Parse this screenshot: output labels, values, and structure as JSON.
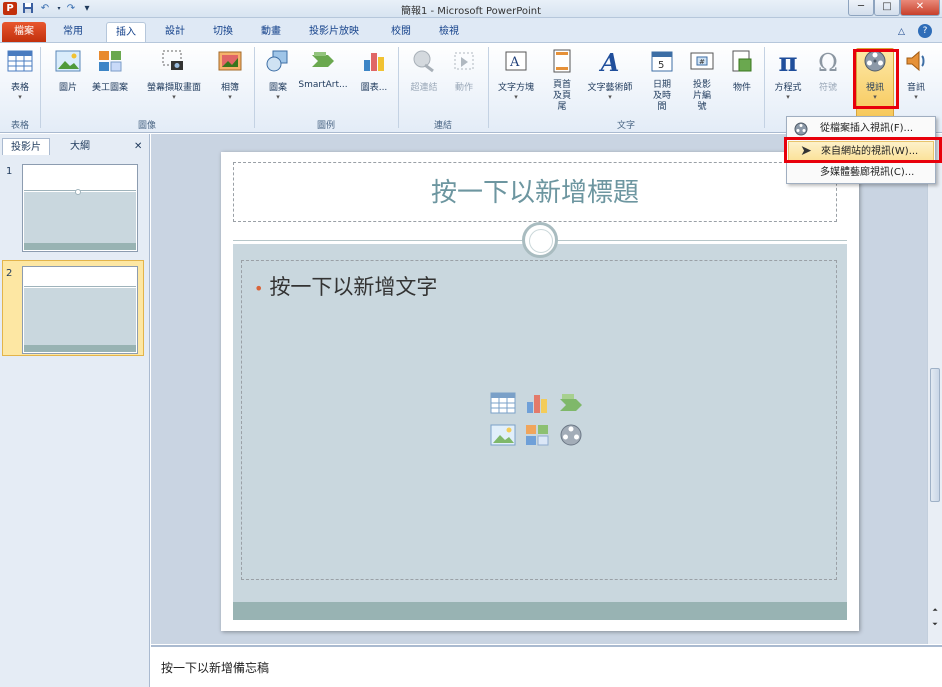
{
  "window": {
    "title": "簡報1 - Microsoft PowerPoint",
    "minimize_label": "─",
    "maximize_label": "□",
    "close_label": "✕"
  },
  "quick_access": {
    "app_icon": "P",
    "save_icon": "floppy-disk-icon",
    "undo_icon": "undo-icon",
    "redo_icon": "redo-icon",
    "customize": "▾"
  },
  "tabs": [
    {
      "label": "檔案",
      "active": false
    },
    {
      "label": "常用",
      "active": false
    },
    {
      "label": "插入",
      "active": true
    },
    {
      "label": "設計",
      "active": false
    },
    {
      "label": "切換",
      "active": false
    },
    {
      "label": "動畫",
      "active": false
    },
    {
      "label": "投影片放映",
      "active": false
    },
    {
      "label": "校閱",
      "active": false
    },
    {
      "label": "檢視",
      "active": false
    }
  ],
  "ribbon": {
    "buttons": [
      {
        "label": "表格",
        "icon": "table-icon",
        "has_arrow": true,
        "disabled": false
      },
      {
        "label": "圖片",
        "icon": "picture-icon",
        "has_arrow": false,
        "disabled": false
      },
      {
        "label": "美工圖案",
        "icon": "clipart-icon",
        "has_arrow": false,
        "disabled": false
      },
      {
        "label": "螢幕擷取畫面",
        "icon": "screenshot-icon",
        "has_arrow": true,
        "disabled": false
      },
      {
        "label": "相簿",
        "icon": "photo-album-icon",
        "has_arrow": true,
        "disabled": false
      },
      {
        "label": "圖案",
        "icon": "shapes-icon",
        "has_arrow": true,
        "disabled": false
      },
      {
        "label": "SmartArt...",
        "icon": "smartart-icon",
        "has_arrow": false,
        "disabled": false
      },
      {
        "label": "圖表...",
        "icon": "chart-icon",
        "has_arrow": false,
        "disabled": false
      },
      {
        "label": "超連結",
        "icon": "hyperlink-icon",
        "has_arrow": false,
        "disabled": true
      },
      {
        "label": "動作",
        "icon": "action-icon",
        "has_arrow": false,
        "disabled": true
      },
      {
        "label": "文字方塊",
        "icon": "textbox-icon",
        "has_arrow": true,
        "disabled": false
      },
      {
        "label": "頁首及頁尾",
        "icon": "header-footer-icon",
        "has_arrow": false,
        "disabled": false
      },
      {
        "label": "文字藝術師",
        "icon": "wordart-icon",
        "has_arrow": true,
        "disabled": false
      },
      {
        "label": "日期及時間",
        "icon": "date-time-icon",
        "has_arrow": false,
        "disabled": false
      },
      {
        "label": "投影片編號",
        "icon": "slide-number-icon",
        "has_arrow": false,
        "disabled": false
      },
      {
        "label": "物件",
        "icon": "object-icon",
        "has_arrow": false,
        "disabled": false
      },
      {
        "label": "方程式",
        "icon": "equation-icon",
        "has_arrow": true,
        "disabled": false
      },
      {
        "label": "符號",
        "icon": "symbol-icon",
        "has_arrow": false,
        "disabled": true
      },
      {
        "label": "視訊",
        "icon": "video-icon",
        "has_arrow": true,
        "disabled": false
      },
      {
        "label": "音訊",
        "icon": "audio-icon",
        "has_arrow": true,
        "disabled": false
      }
    ],
    "groups": [
      "表格",
      "圖像",
      "圖例",
      "連結",
      "文字"
    ],
    "minimize_ribbon": "△",
    "help": "?"
  },
  "video_menu": {
    "items": [
      {
        "label": "從檔案插入視訊(F)...",
        "icon": "film-reel-icon"
      },
      {
        "label": "來自網站的視訊(W)...",
        "icon": ""
      },
      {
        "label": "多媒體藝廊視訊(C)...",
        "icon": ""
      }
    ]
  },
  "left_panel": {
    "tabs": [
      "投影片",
      "大綱"
    ],
    "close": "✕",
    "slide_numbers": [
      "1",
      "2"
    ]
  },
  "slide": {
    "title_placeholder": "按一下以新增標題",
    "body_placeholder": "按一下以新增文字",
    "bullet": "•"
  },
  "notes": {
    "placeholder": "按一下以新增備忘稿"
  },
  "colors": {
    "file_tab": "#c2300c",
    "accent_orange": "#d9643a",
    "highlight_red": "#e8000b",
    "slide_title": "#6d96a0",
    "slide_band": "#98b3b3"
  }
}
